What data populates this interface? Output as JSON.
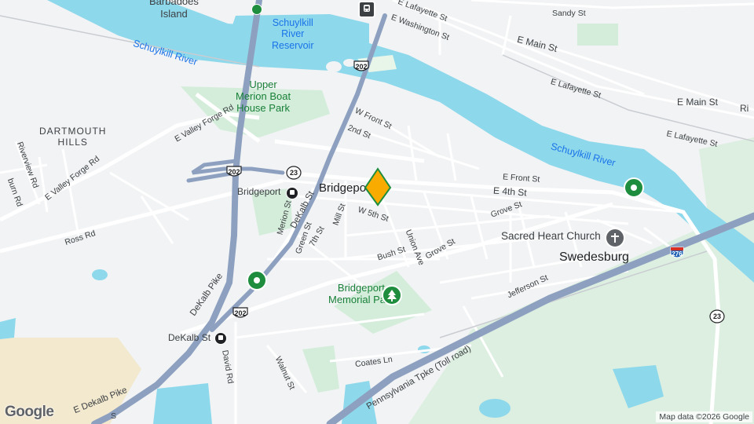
{
  "map": {
    "labels": {
      "barbadoes_island": "Barbadoes\nIsland",
      "schuylkill_river_reservoir": "Schuylkill\nRiver\nReservoir",
      "schuylkill_river_1": "Schuylkill River",
      "schuylkill_river_2": "Schuylkill River",
      "upper_merion_boat_house_park": "Upper\nMerion Boat\nHouse Park",
      "dartmouth_hills": "DARTMOUTH\nHILLS",
      "bridgeport": "Bridgeport",
      "swedesburg": "Swedesburg",
      "sacred_heart_church": "Sacred Heart Church",
      "bridgeport_memorial_park": "Bridgeport\nMemorial Park",
      "bridgeport_station": "Bridgeport",
      "dekalb_st_station": "DeKalb St"
    },
    "streets": {
      "e_lafayette_st_top": "E Lafayette St",
      "e_washington_st": "E Washington St",
      "sandy_st": "Sandy St",
      "e_main_st_1": "E Main St",
      "e_main_st_2": "E Main St",
      "e_lafayette_st_mid": "E Lafayette St",
      "e_lafayette_st_right": "E Lafayette St",
      "ri_cut": "Ri",
      "w_front_st": "W Front St",
      "second_st": "2nd St",
      "e_valley_forge_rd_1": "E Valley Forge Rd",
      "e_valley_forge_rd_2": "E Valley Forge Rd",
      "riverview_rd": "Riverview Rd",
      "burn_rd": "burn Rd",
      "ross_rd": "Ross Rd",
      "e_front_st": "E Front St",
      "e_fourth_st": "E 4th St",
      "w_fifth_st": "W 5th St",
      "mill_st": "Mill St",
      "seventh_st": "7th St",
      "green_st_1": "Green St",
      "merion_st": "Merion St",
      "dekalb_st": "DeKalb St",
      "grove_st_1": "Grove St",
      "grove_st_2": "Grove St",
      "bush_st": "Bush St",
      "union_ave": "Union Ave",
      "jefferson_st": "Jefferson St",
      "dekalb_pike_1": "DeKalb Pike",
      "dekalb_pike_2": "E Dekalb Pike",
      "david_rd": "David Rd",
      "walnut_st": "Walnut St",
      "coates_ln": "Coates Ln",
      "penn_tpke": "Pennsylvania Tpke (Toll road)",
      "s_cut": "S"
    },
    "shields": {
      "us202_a": "202",
      "us202_b": "202",
      "us202_c": "202",
      "pa23_a": "23",
      "pa23_b": "23",
      "i276": "276"
    },
    "colors": {
      "land": "#f1f3f4",
      "water": "#8ed8ec",
      "park": "#d4edda",
      "highway": "#8da0bf",
      "road": "#ffffff",
      "pin": "#f9ab00",
      "pin_outline": "#1e8e3e",
      "poi_green": "#1e8e3e"
    },
    "icons": {
      "pin": "location-pin-icon",
      "train": "train-station-icon",
      "church": "church-icon",
      "park": "park-tree-icon"
    }
  },
  "attribution": {
    "logo": "Google",
    "text": "Map data ©2026 Google"
  }
}
